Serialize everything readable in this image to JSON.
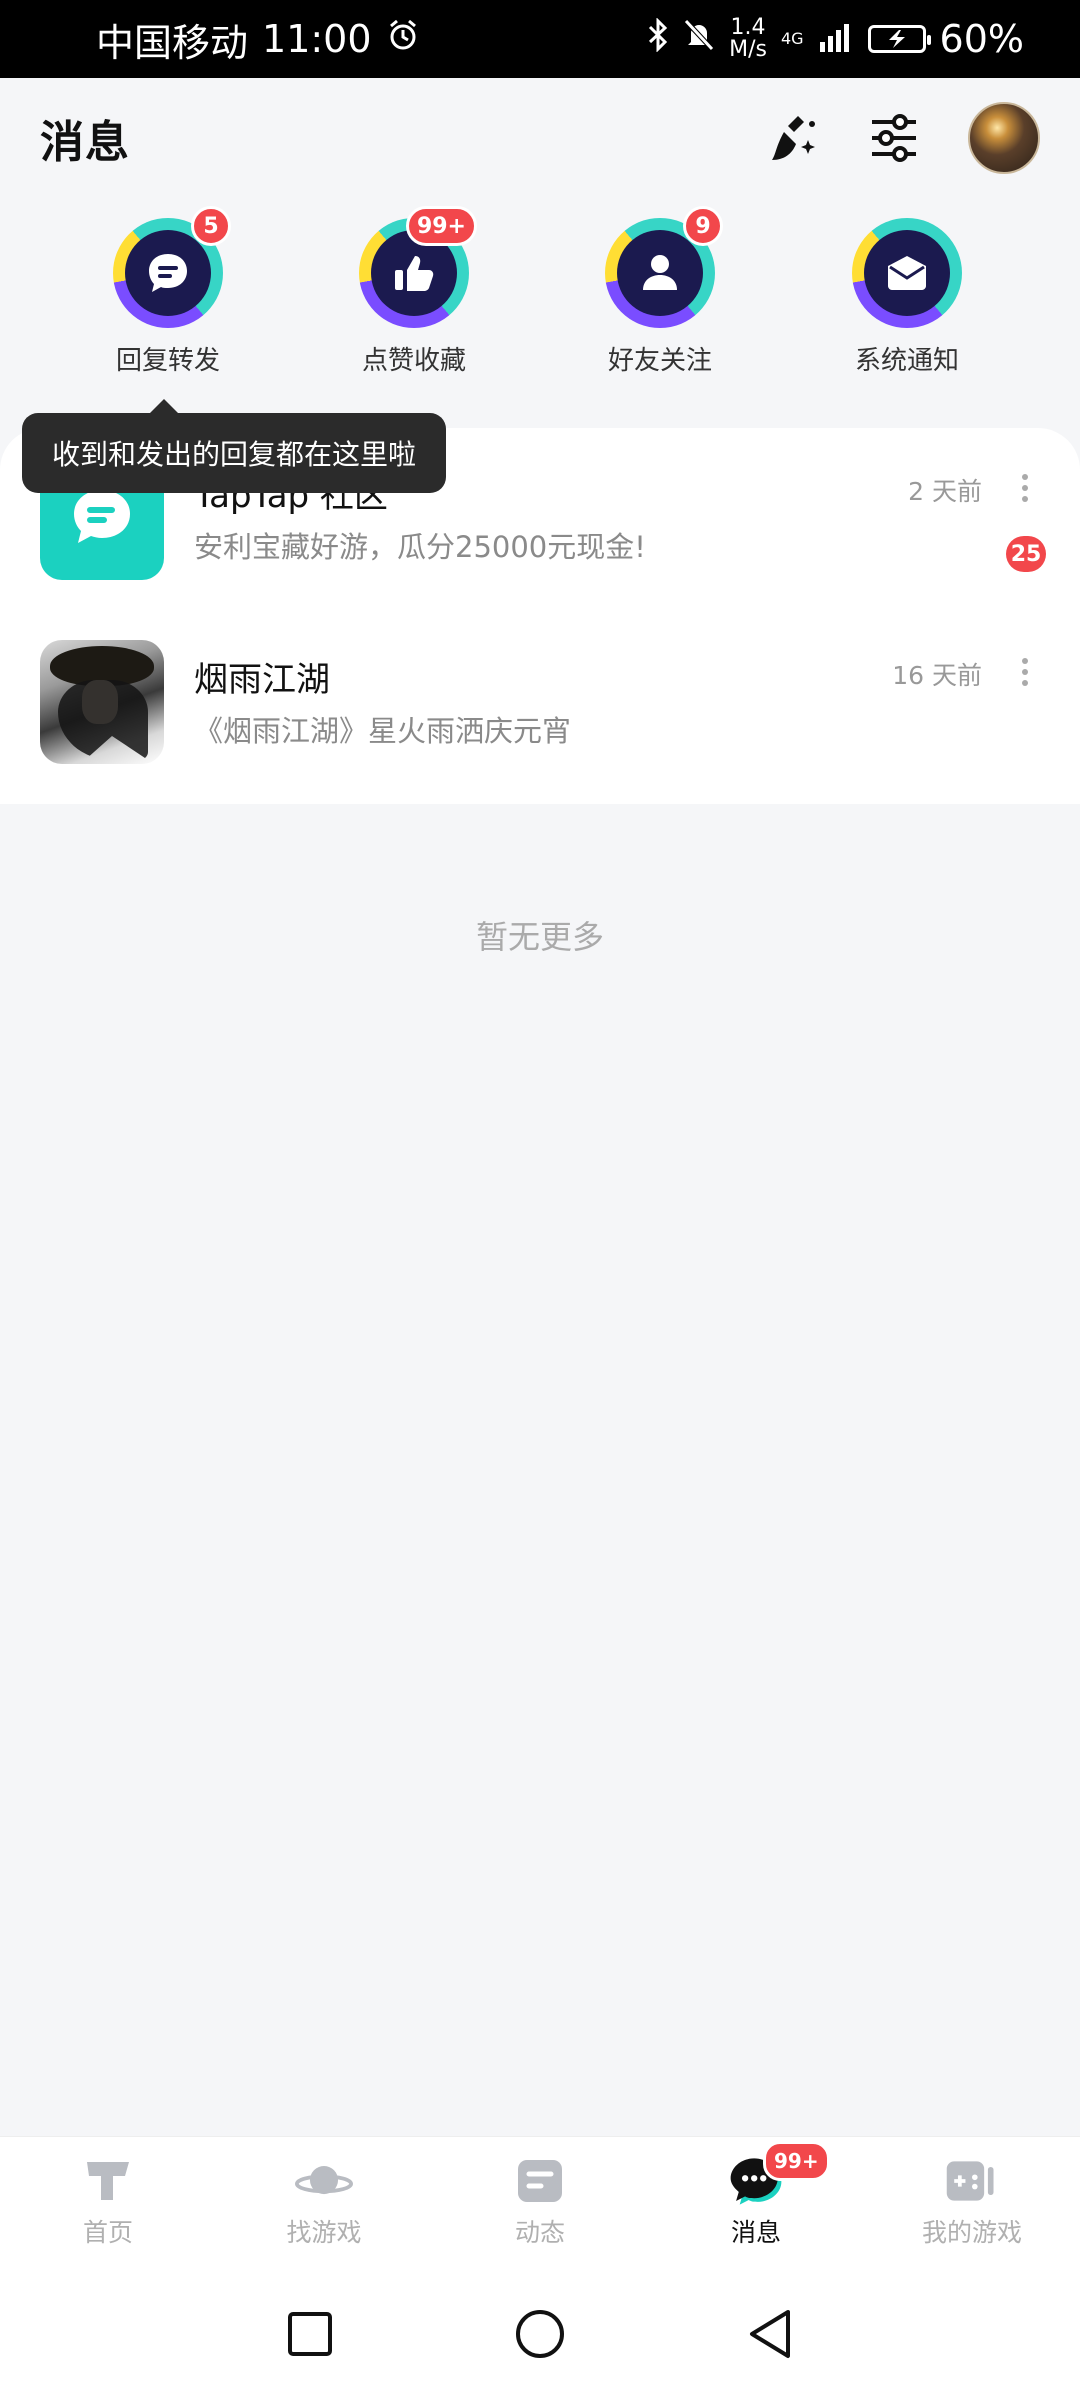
{
  "status_bar": {
    "carrier": "中国移动",
    "time": "11:00",
    "speed_value": "1.4",
    "speed_unit": "M/s",
    "network": "4G",
    "battery": "60%"
  },
  "header": {
    "title": "消息"
  },
  "categories": [
    {
      "label": "回复转发",
      "badge": "5",
      "icon": "chat-bubble-icon"
    },
    {
      "label": "点赞收藏",
      "badge": "99+",
      "icon": "thumbs-up-icon"
    },
    {
      "label": "好友关注",
      "badge": "9",
      "icon": "person-icon"
    },
    {
      "label": "系统通知",
      "badge": "",
      "icon": "envelope-icon"
    }
  ],
  "tooltip": {
    "text": "收到和发出的回复都在这里啦"
  },
  "messages": [
    {
      "title": "TapTap 社区",
      "preview": "安利宝藏好游，瓜分25000元现金!",
      "time": "2 天前",
      "unread": "25"
    },
    {
      "title": "烟雨江湖",
      "preview": "《烟雨江湖》星火雨洒庆元宵",
      "time": "16 天前",
      "unread": ""
    }
  ],
  "list_footer": "暂无更多",
  "bottom_nav": {
    "items": [
      {
        "label": "首页",
        "icon": "taptap-home-icon"
      },
      {
        "label": "找游戏",
        "icon": "planet-icon"
      },
      {
        "label": "动态",
        "icon": "feed-icon"
      },
      {
        "label": "消息",
        "icon": "message-icon",
        "badge": "99+",
        "active": true
      },
      {
        "label": "我的游戏",
        "icon": "gamepad-icon"
      }
    ]
  },
  "colors": {
    "accent": "#1bd1c0",
    "badge": "#f2474b",
    "background": "#f5f6f8"
  }
}
